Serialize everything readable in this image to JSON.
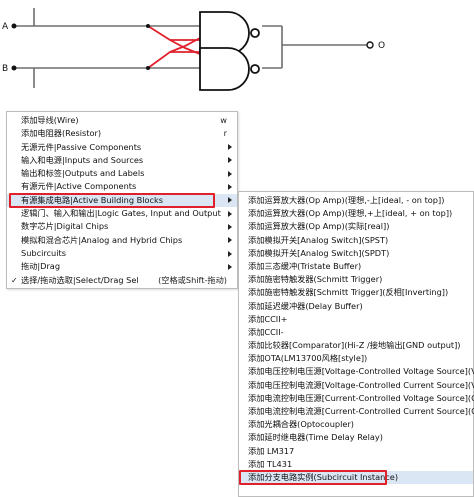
{
  "circuit": {
    "input_a_label": "A",
    "input_b_label": "B",
    "output_label": "O",
    "wire_color": "#6e6e6e",
    "active_wire_color": "#e0212c"
  },
  "main_menu": {
    "items": [
      {
        "label": "添加导线(Wire)",
        "shortcut": "w",
        "submenu": false
      },
      {
        "label": "添加电阻器(Resistor)",
        "shortcut": "r",
        "submenu": false
      },
      {
        "label": "无源元件|Passive Components",
        "shortcut": "",
        "submenu": true
      },
      {
        "label": "输入和电源|Inputs and Sources",
        "shortcut": "",
        "submenu": true
      },
      {
        "label": "输出和标签|Outputs and Labels",
        "shortcut": "",
        "submenu": true
      },
      {
        "label": "有源元件|Active Components",
        "shortcut": "",
        "submenu": true
      },
      {
        "label": "有源集成电路|Active Building Blocks",
        "shortcut": "",
        "submenu": true,
        "selected": true
      },
      {
        "label": "逻辑门、输入和输出|Logic Gates, Input and Output",
        "shortcut": "",
        "submenu": true
      },
      {
        "label": "数字芯片|Digital Chips",
        "shortcut": "",
        "submenu": true
      },
      {
        "label": "模拟和混合芯片|Analog and Hybrid Chips",
        "shortcut": "",
        "submenu": true
      },
      {
        "label": "Subcircuits",
        "shortcut": "",
        "submenu": true
      },
      {
        "label": "拖动|Drag",
        "shortcut": "",
        "submenu": true
      },
      {
        "label": "选择/拖动选取|Select/Drag Sel",
        "shortcut": "(空格或Shift-拖动)",
        "submenu": false,
        "checked": true
      }
    ],
    "check_mark": "✓"
  },
  "sub_menu": {
    "items": [
      {
        "label": "添加运算放大器(Op Amp)(理想,-上[ideal, - on top])"
      },
      {
        "label": "添加运算放大器(Op Amp)(理想,+上[ideal, + on top])"
      },
      {
        "label": "添加运算放大器(Op Amp)(实际[real])"
      },
      {
        "label": "添加模拟开关[Analog Switch](SPST)"
      },
      {
        "label": "添加模拟开关[Analog Switch](SPDT)"
      },
      {
        "label": "添加三态缓冲(Tristate Buffer)"
      },
      {
        "label": "添加施密特触发器(Schmitt Trigger)"
      },
      {
        "label": "添加施密特触发器[Schmitt Trigger](反相[Inverting])"
      },
      {
        "label": "添加延迟缓冲器(Delay Buffer)"
      },
      {
        "label": "添加CCII+"
      },
      {
        "label": "添加CCII-"
      },
      {
        "label": "添加比较器[Comparator](Hi-Z /接地输出[GND output])"
      },
      {
        "label": "添加OTA(LM13700风格[style])"
      },
      {
        "label": "添加电压控制电压源[Voltage-Controlled Voltage Source](VCVS)"
      },
      {
        "label": "添加电压控制电流源[Voltage-Controlled Current Source](VCCS)"
      },
      {
        "label": "添加电流控制电压源[Current-Controlled Voltage Source](CCVS)"
      },
      {
        "label": "添加电流控制电流源[Current-Controlled Current Source](CCCS)"
      },
      {
        "label": "添加光耦合器(Optocoupler)"
      },
      {
        "label": "添加延时继电器(Time Delay Relay)"
      },
      {
        "label": "添加 LM317"
      },
      {
        "label": "添加 TL431"
      },
      {
        "label": "添加分支电路实例(Subcircuit Instance)",
        "selected": true
      }
    ]
  }
}
